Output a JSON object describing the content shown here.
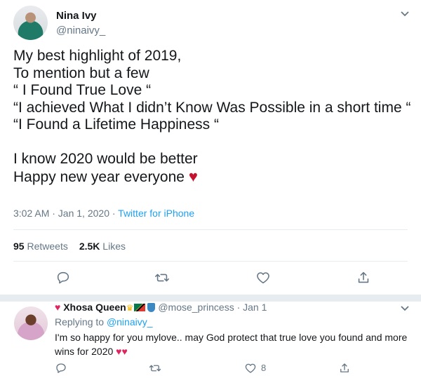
{
  "tweet": {
    "author_name": "Nina Ivy",
    "author_handle": "@ninaivy_",
    "lines": [
      "My best highlight of 2019,",
      "To mention but a few",
      "“ I Found True Love “",
      "“I achieved What I didn’t Know Was Possible in a short time “",
      "“I Found a Lifetime Happiness “",
      "",
      "I know 2020 would be better",
      "Happy new year everyone"
    ],
    "heart_emoji": "♥",
    "time": "3:02 AM · Jan 1, 2020 · ",
    "source": "Twitter for iPhone",
    "retweets_count": "95",
    "retweets_label": "Retweets",
    "likes_count": "2.5K",
    "likes_label": "Likes"
  },
  "reply": {
    "name_prefix_heart": "♥",
    "name": "Xhosa Queen",
    "crown": "♛",
    "handle": "@mose_princess",
    "date": " · Jan 1",
    "replying_label": "Replying to ",
    "replying_handle": "@ninaivy_",
    "text": "I'm so happy for you mylove.. may God protect that true love you found and more wins for 2020 ",
    "hearts": "♥♥",
    "like_count": "8"
  },
  "colors": {
    "accent": "#1da1f2",
    "muted": "#657786",
    "heart_red": "#c4122f"
  },
  "icons": [
    "chevron-down-icon",
    "reply-icon",
    "retweet-icon",
    "like-icon",
    "share-icon"
  ]
}
